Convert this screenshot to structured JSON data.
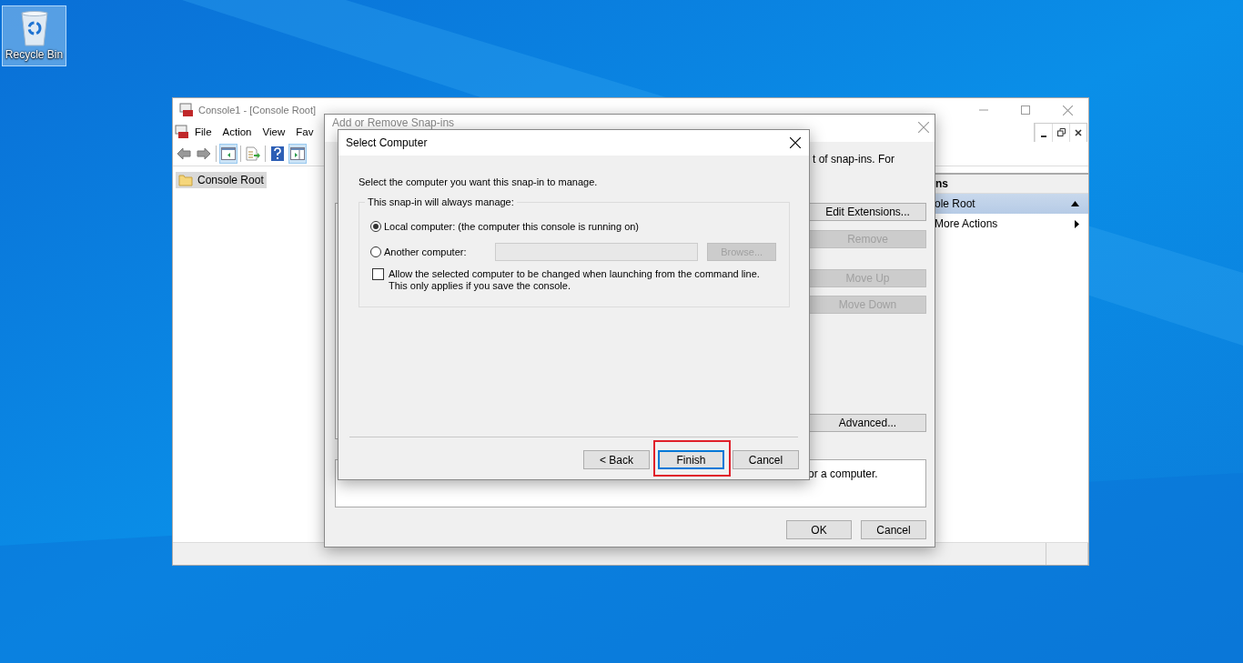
{
  "desktop": {
    "icons": [
      {
        "label": "Recycle Bin",
        "selected": true
      }
    ]
  },
  "console": {
    "title": "Console1 - [Console Root]",
    "menu": [
      "File",
      "Action",
      "View",
      "Fav"
    ],
    "tree": [
      {
        "label": "Console Root",
        "selected": true
      }
    ],
    "actions": {
      "header": "ns",
      "items": [
        {
          "label": "ole Root",
          "kind": "section",
          "selected": true
        },
        {
          "label": "More Actions",
          "kind": "submenu",
          "selected": false
        }
      ]
    }
  },
  "snapins_dialog": {
    "title": "Add or Remove Snap-ins",
    "fragments": [
      "t of snap-ins. For"
    ],
    "side_buttons": [
      {
        "label": "Edit Extensions...",
        "disabled": false
      },
      {
        "label": "Remove",
        "disabled": true
      },
      {
        "label": "Move Up",
        "disabled": true
      },
      {
        "label": "Move Down",
        "disabled": true
      },
      {
        "label": "Advanced...",
        "disabled": false
      }
    ],
    "description": "or a computer.",
    "buttons": [
      "OK",
      "Cancel"
    ]
  },
  "select_dialog": {
    "title": "Select Computer",
    "prompt": "Select the computer you want this snap-in to manage.",
    "group_label": "This snap-in will always manage:",
    "options": [
      {
        "label": "Local computer:  (the computer this console is running on)",
        "selected": true
      },
      {
        "label": "Another computer:",
        "selected": false
      }
    ],
    "computer_field": {
      "disabled": true
    },
    "browse": {
      "label": "Browse...",
      "disabled": true
    },
    "allow_change": {
      "label": "Allow the selected computer to be changed when launching from the command line.  This only applies if you save the console.",
      "checked": false
    },
    "buttons": [
      {
        "label": "< Back",
        "default": false,
        "highlighted": false
      },
      {
        "label": "Finish",
        "default": true,
        "highlighted": true
      },
      {
        "label": "Cancel",
        "default": false,
        "highlighted": false
      }
    ]
  }
}
